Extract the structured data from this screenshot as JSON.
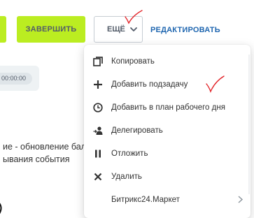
{
  "toolbar": {
    "finish_label": "ЗАВЕРШИТЬ",
    "more_label": "ЕЩЁ",
    "edit_label": "РЕДАКТИРОВАТЬ"
  },
  "task": {
    "time_value": "00:00:00",
    "description_line1": "ие - обновление бала",
    "description_line2": "ывания события"
  },
  "menu": {
    "items": [
      {
        "label": "Копировать",
        "icon": "copy-icon"
      },
      {
        "label": "Добавить подзадачу",
        "icon": "plus-icon"
      },
      {
        "label": "Добавить в план рабочего дня",
        "icon": "clock-icon"
      },
      {
        "label": "Делегировать",
        "icon": "delegate-icon"
      },
      {
        "label": "Отложить",
        "icon": "pause-icon"
      },
      {
        "label": "Удалить",
        "icon": "close-icon"
      },
      {
        "label": "Битрикс24.Маркет",
        "icon": "chevron-right-icon"
      }
    ]
  },
  "colors": {
    "accent_green": "#bbed21",
    "link_blue": "#2067b0",
    "annotation_red": "#e3262b",
    "text_dark": "#333333"
  }
}
